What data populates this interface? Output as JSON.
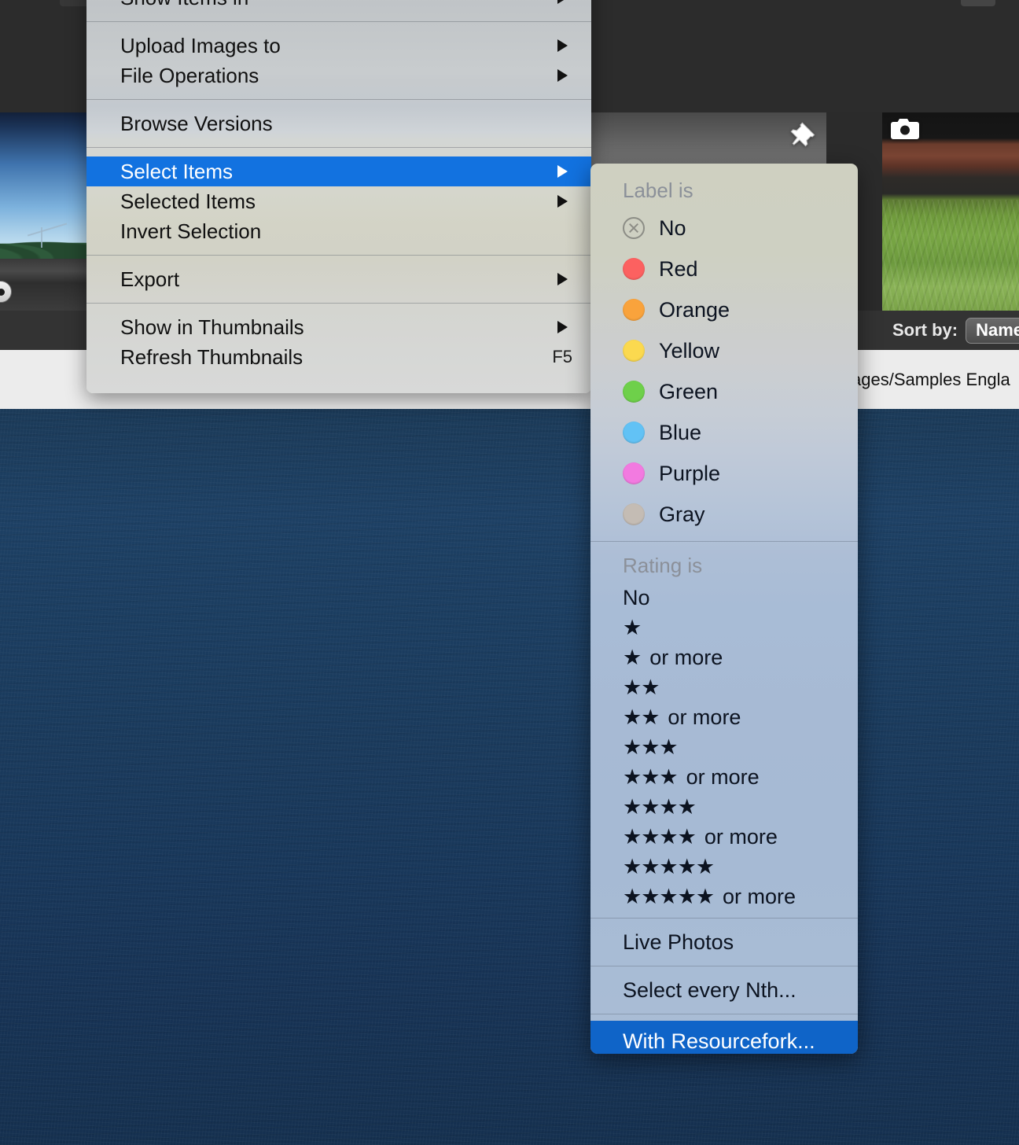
{
  "app": {
    "sortbar": {
      "label": "Sort by:",
      "value": "Name"
    },
    "pathbar": {
      "text": "ages/Samples Engla"
    },
    "thumbnails": [
      {
        "name": "sky-bridge-thumbnail",
        "badge": "nav-knob-icon"
      },
      {
        "name": "gray-gradient-thumbnail",
        "badge": "pin-icon"
      },
      {
        "name": "grass-wall-thumbnail",
        "badge": "camera-icon"
      }
    ]
  },
  "context_menu": {
    "items": [
      {
        "label": "Show Items in",
        "submenu": true,
        "shortcut": "",
        "selected": false
      },
      {
        "label": "Upload Images to",
        "submenu": true,
        "shortcut": "",
        "selected": false
      },
      {
        "label": "File Operations",
        "submenu": true,
        "shortcut": "",
        "selected": false
      },
      {
        "label": "Browse Versions",
        "submenu": false,
        "shortcut": "",
        "selected": false
      },
      {
        "label": "Select Items",
        "submenu": true,
        "shortcut": "",
        "selected": true
      },
      {
        "label": "Selected Items",
        "submenu": true,
        "shortcut": "",
        "selected": false
      },
      {
        "label": "Invert Selection",
        "submenu": false,
        "shortcut": "",
        "selected": false
      },
      {
        "label": "Export",
        "submenu": true,
        "shortcut": "",
        "selected": false
      },
      {
        "label": "Show in Thumbnails",
        "submenu": true,
        "shortcut": "",
        "selected": false
      },
      {
        "label": "Refresh Thumbnails",
        "submenu": false,
        "shortcut": "F5",
        "selected": false
      }
    ]
  },
  "submenu": {
    "label_section": {
      "header": "Label is",
      "items": [
        {
          "label": "No",
          "color": "none",
          "icon": "circle-x-icon"
        },
        {
          "label": "Red",
          "color": "#fc6160",
          "icon": "color-swatch"
        },
        {
          "label": "Orange",
          "color": "#f9a33c",
          "icon": "color-swatch"
        },
        {
          "label": "Yellow",
          "color": "#fbd94f",
          "icon": "color-swatch"
        },
        {
          "label": "Green",
          "color": "#6ed04a",
          "icon": "color-swatch"
        },
        {
          "label": "Blue",
          "color": "#62c2f5",
          "icon": "color-swatch"
        },
        {
          "label": "Purple",
          "color": "#f27ae0",
          "icon": "color-swatch"
        },
        {
          "label": "Gray",
          "color": "#c4bcb4",
          "icon": "color-swatch"
        }
      ]
    },
    "rating_section": {
      "header": "Rating is",
      "items": [
        {
          "stars": "",
          "label": "No"
        },
        {
          "stars": "★",
          "label": ""
        },
        {
          "stars": "★",
          "label": "or more"
        },
        {
          "stars": "★★",
          "label": ""
        },
        {
          "stars": "★★",
          "label": "or more"
        },
        {
          "stars": "★★★",
          "label": ""
        },
        {
          "stars": "★★★",
          "label": "or more"
        },
        {
          "stars": "★★★★",
          "label": ""
        },
        {
          "stars": "★★★★",
          "label": "or more"
        },
        {
          "stars": "★★★★★",
          "label": ""
        },
        {
          "stars": "★★★★★",
          "label": "or more"
        }
      ]
    },
    "extra_items": [
      {
        "label": "Live Photos",
        "selected": false
      },
      {
        "label": "Select every Nth...",
        "selected": false
      },
      {
        "label": "With Resourcefork...",
        "selected": true
      }
    ]
  },
  "colors": {
    "highlight": "#1272e0",
    "submenu_highlight": "#0f64c8",
    "menu_text": "#101010",
    "header_text": "#8b9099"
  }
}
